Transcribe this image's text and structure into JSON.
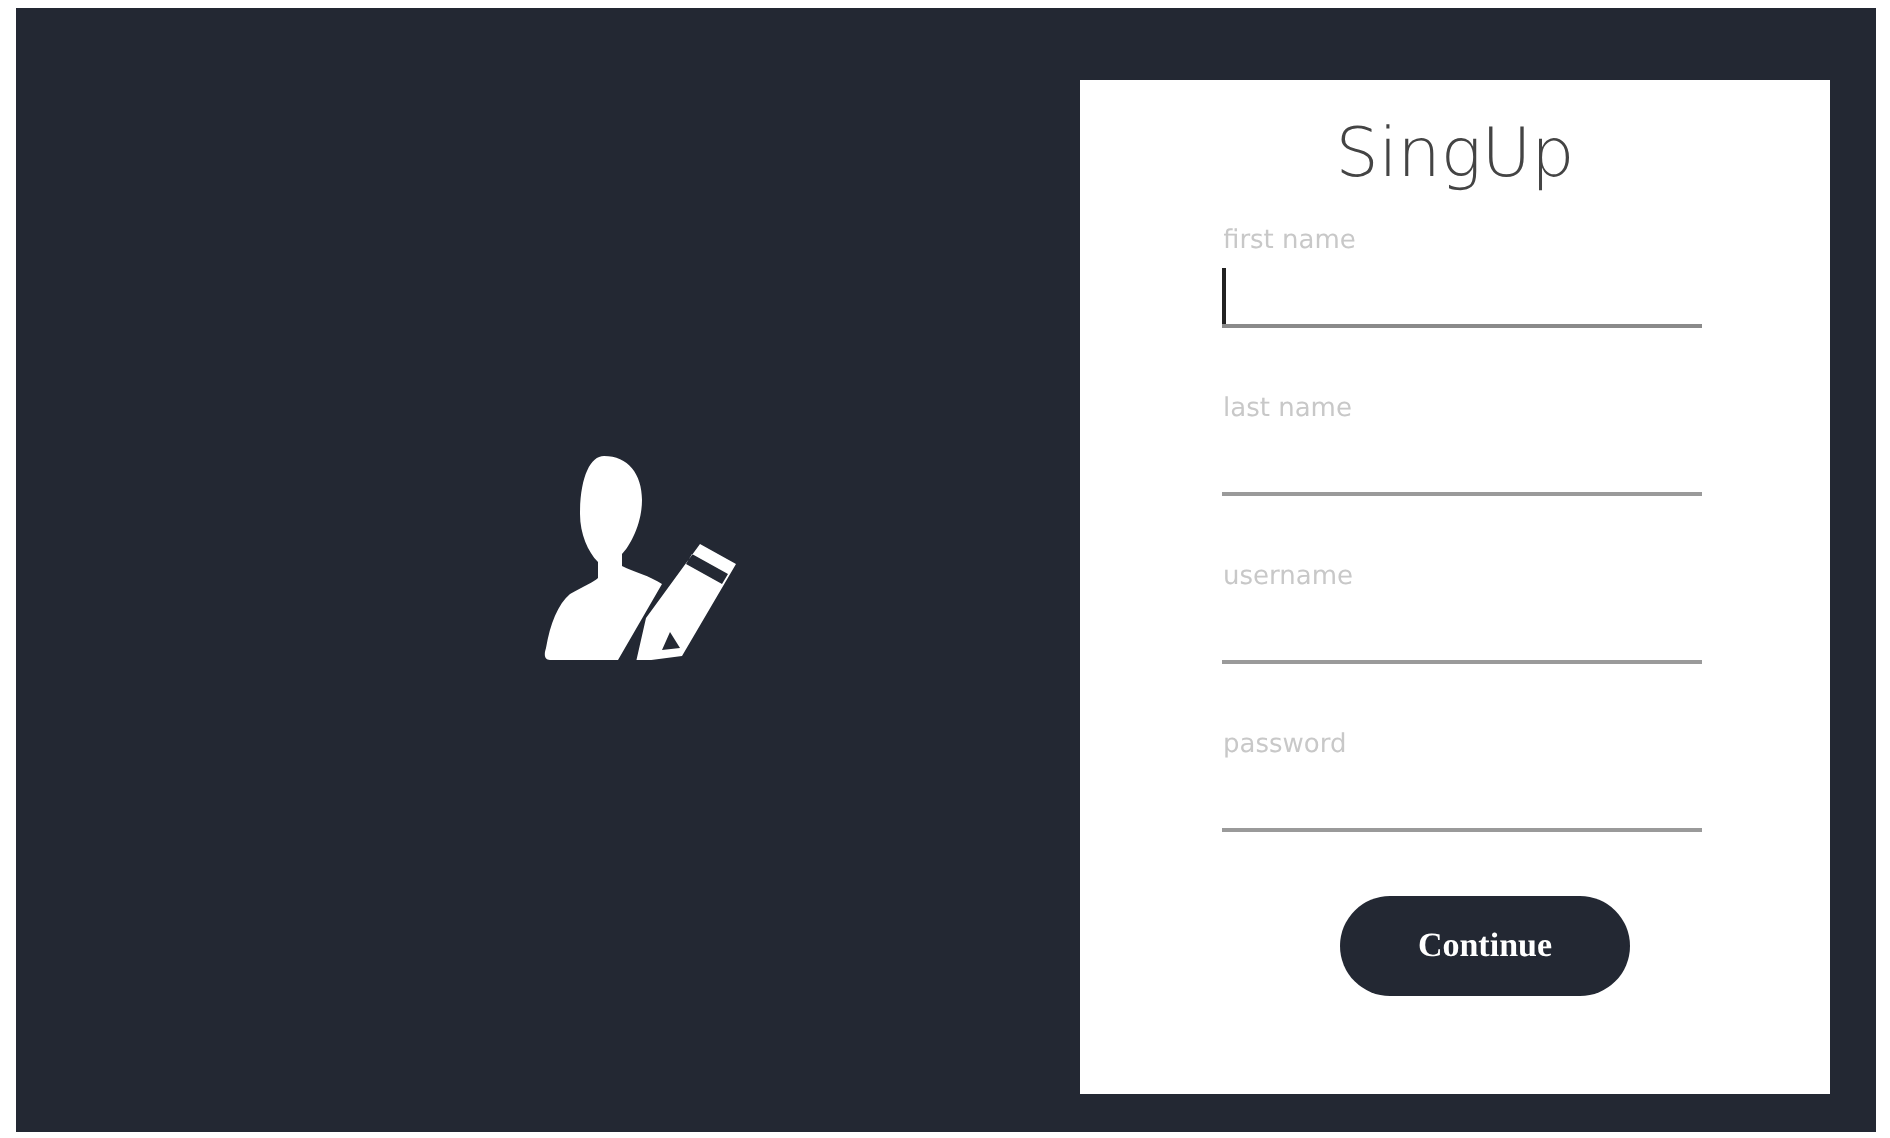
{
  "form": {
    "title": "SingUp",
    "fields": [
      {
        "placeholder": "first name",
        "focused": true
      },
      {
        "placeholder": "last name",
        "focused": false
      },
      {
        "placeholder": "username",
        "focused": false
      },
      {
        "placeholder": "password",
        "focused": false
      }
    ],
    "button": "Continue"
  }
}
